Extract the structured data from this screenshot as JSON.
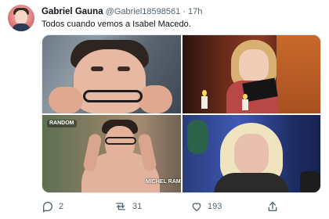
{
  "tweet": {
    "author_name": "Gabriel Gauna",
    "author_handle": "@Gabriel18598561",
    "separator": "·",
    "time": "17h",
    "text": "Todos cuando vemos a Isabel Macedo."
  },
  "media": {
    "images": [
      {
        "icon": "boy-with-glasses-image"
      },
      {
        "icon": "woman-with-book-and-candles-image"
      },
      {
        "icon": "boy-adjusting-glasses-image",
        "logo_text": "RANDOM",
        "watermark_text": "MICHEL RAMIREZ"
      },
      {
        "icon": "blonde-woman-tv-image"
      }
    ]
  },
  "actions": {
    "reply_count": "2",
    "retweet_count": "31",
    "like_count": "193",
    "share_icon": "share-icon"
  },
  "colors": {
    "text_primary": "#0f1419",
    "text_secondary": "#536471",
    "divider": "#e1e8ed"
  }
}
